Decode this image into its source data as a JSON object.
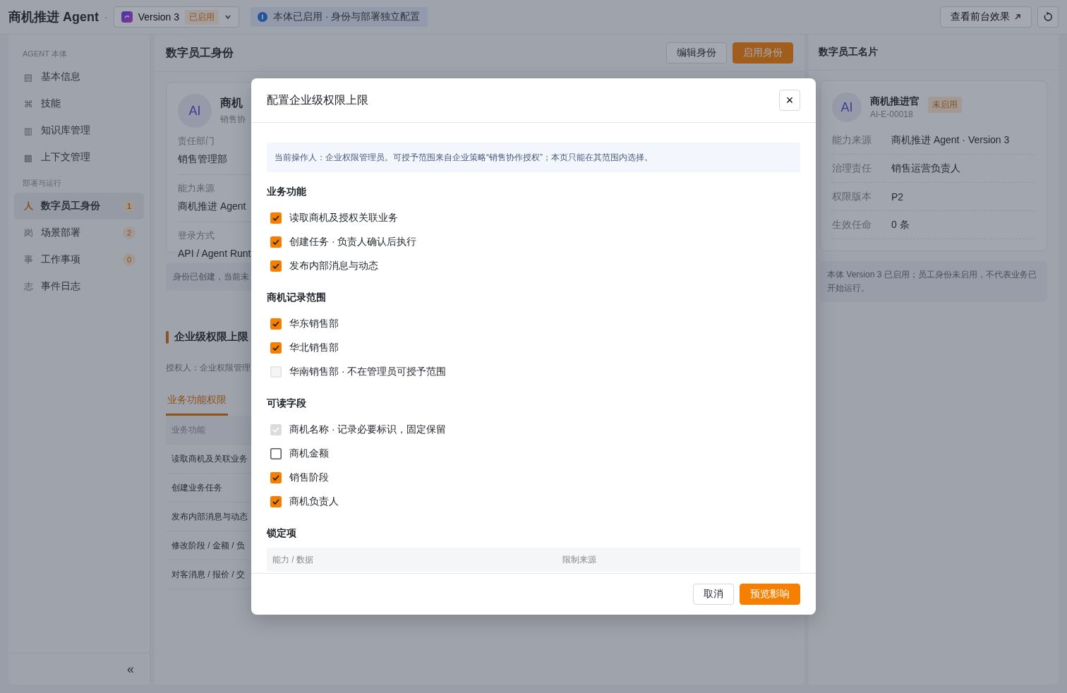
{
  "header": {
    "title": "商机推进 Agent",
    "separator": "·",
    "version": {
      "label": "Version 3",
      "status": "已启用"
    },
    "notice": "本体已启用 · 身份与部署独立配置",
    "action": "查看前台效果"
  },
  "sidebar": {
    "groups": [
      {
        "title": "AGENT 本体",
        "items": [
          {
            "icon": "▤",
            "label": "基本信息",
            "selected": false
          },
          {
            "icon": "⌘",
            "label": "技能",
            "selected": false
          },
          {
            "icon": "▥",
            "label": "知识库管理",
            "selected": false
          },
          {
            "icon": "▩",
            "label": "上下文管理",
            "selected": false
          }
        ]
      },
      {
        "title": "部署与运行",
        "items": [
          {
            "icon": "人",
            "label": "数字员工身份",
            "count": "1",
            "selected": true
          },
          {
            "icon": "岗",
            "label": "场景部署",
            "count": "2",
            "selected": false
          },
          {
            "icon": "事",
            "label": "工作事项",
            "count": "0",
            "selected": false
          },
          {
            "icon": "志",
            "label": "事件日志",
            "selected": false
          }
        ]
      }
    ],
    "collapse": "«"
  },
  "main": {
    "title": "数字员工身份",
    "buttons": [
      {
        "label": "编辑身份",
        "kind": "secondary"
      },
      {
        "label": "启用身份",
        "kind": "primary"
      }
    ],
    "identity": {
      "avatar": "AI",
      "name": "商机",
      "subtitle": "销售协",
      "fields": [
        {
          "label": "责任部门",
          "value": "销售管理部"
        },
        {
          "label": "能力来源",
          "value": "商机推进 Agent"
        },
        {
          "label": "登录方式",
          "value": "API / Agent Runt"
        }
      ]
    },
    "note": "身份已创建，当前未",
    "section": {
      "title": "企业级权限上限",
      "grantor": "授权人：企业权限管理",
      "tabs": [
        {
          "label": "业务功能权限",
          "selected": true
        }
      ],
      "table": {
        "header": "业务功能",
        "rows": [
          "读取商机及关联业务",
          "创建业务任务",
          "发布内部消息与动态",
          "修改阶段 / 金额 / 负",
          "对客消息 / 报价 / 交"
        ]
      }
    }
  },
  "namecard": {
    "title": "数字员工名片",
    "avatar": "AI",
    "name": "商机推进官",
    "id": "AI-E-00018",
    "badge": "未启用",
    "rows": [
      {
        "label": "能力来源",
        "value": "商机推进 Agent · Version 3"
      },
      {
        "label": "治理责任",
        "value": "销售运营负责人"
      },
      {
        "label": "权限版本",
        "value": "P2"
      },
      {
        "label": "生效任命",
        "value": "0 条"
      }
    ],
    "note": "本体 Version 3 已启用；员工身份未启用，不代表业务已开始运行。"
  },
  "modal": {
    "title": "配置企业级权限上限",
    "close": "×",
    "info": "当前操作人：企业权限管理员。可授予范围来自企业策略“销售协作授权”；本页只能在其范围内选择。",
    "sections": [
      {
        "title": "业务功能",
        "items": [
          {
            "label": "读取商机及授权关联业务",
            "checked": true,
            "disabled": false
          },
          {
            "label": "创建任务 · 负责人确认后执行",
            "checked": true,
            "disabled": false
          },
          {
            "label": "发布内部消息与动态",
            "checked": true,
            "disabled": false
          }
        ]
      },
      {
        "title": "商机记录范围",
        "items": [
          {
            "label": "华东销售部",
            "checked": true,
            "disabled": false
          },
          {
            "label": "华北销售部",
            "checked": true,
            "disabled": false
          },
          {
            "label": "华南销售部 · 不在管理员可授予范围",
            "checked": false,
            "disabled": true
          }
        ]
      },
      {
        "title": "可读字段",
        "items": [
          {
            "label": "商机名称 · 记录必要标识，固定保留",
            "checked": true,
            "disabled": true
          },
          {
            "label": "商机金额",
            "checked": false,
            "disabled": false
          },
          {
            "label": "销售阶段",
            "checked": true,
            "disabled": false
          },
          {
            "label": "商机负责人",
            "checked": true,
            "disabled": false
          }
        ]
      }
    ],
    "locked": {
      "title": "锁定项",
      "columns": [
        "能力 / 数据",
        "限制来源"
      ]
    },
    "buttons": [
      {
        "label": "取消",
        "kind": "secondary"
      },
      {
        "label": "预览影响",
        "kind": "primary"
      }
    ]
  }
}
